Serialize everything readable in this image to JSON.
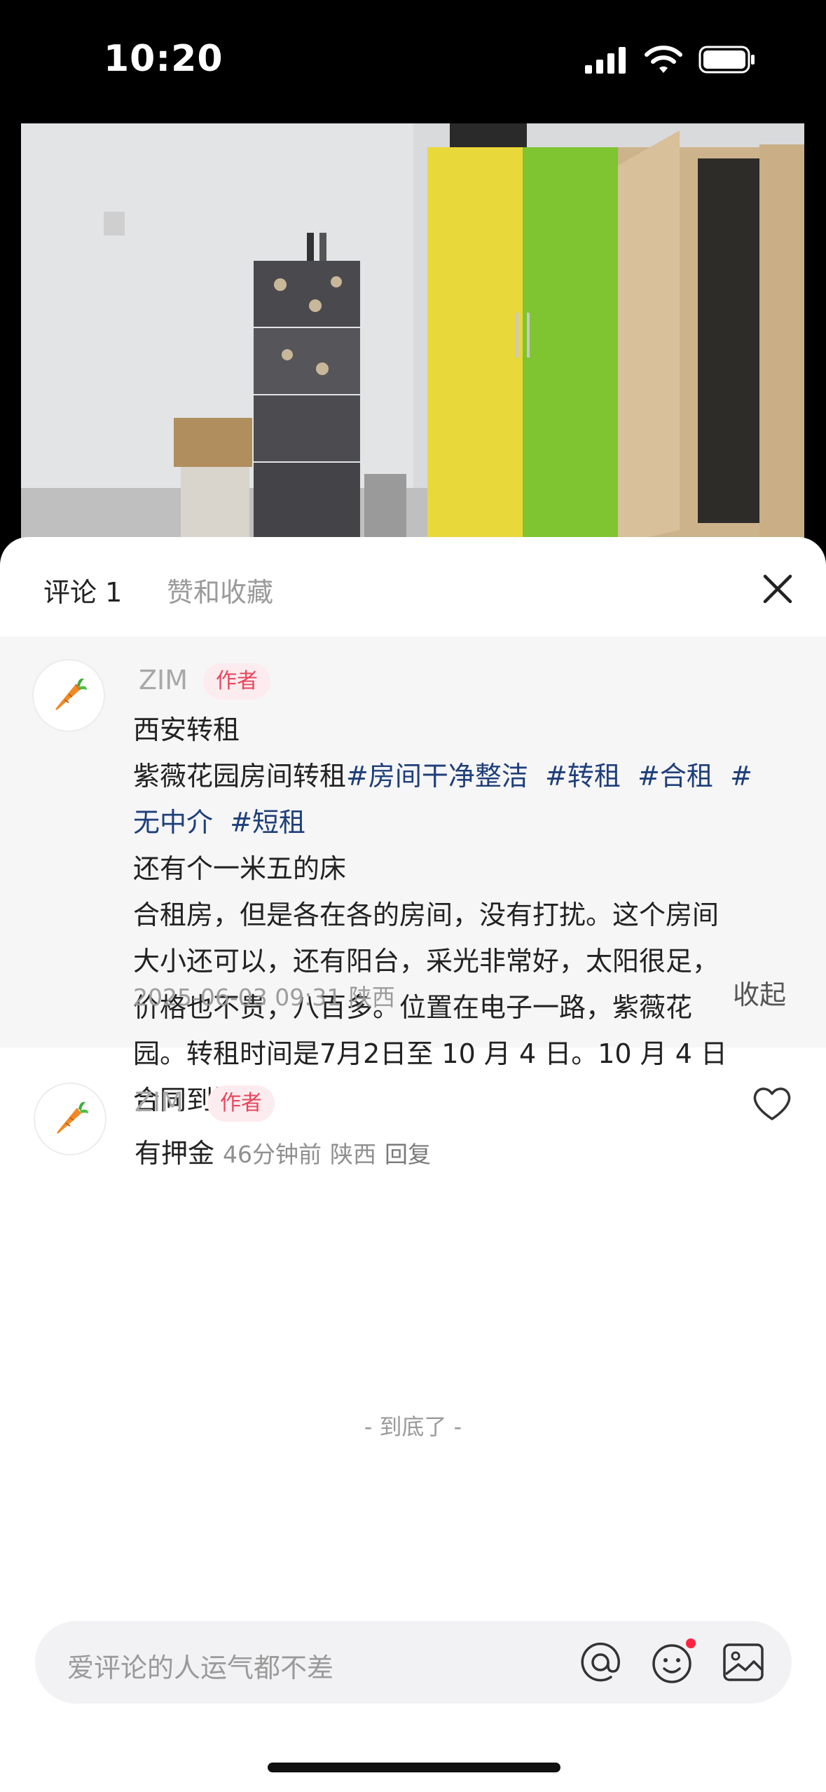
{
  "status_bar": {
    "time": "10:20"
  },
  "tabs": {
    "comments": "评论 1",
    "likes_favorites": "赞和收藏"
  },
  "note": {
    "author": "ZIM",
    "author_badge": "作者",
    "title": "西安转租",
    "line2_text": "紫薇花园房间转租",
    "tags_line2": [
      "#房间干净整洁",
      "#转租",
      "#合租",
      "#"
    ],
    "tags_line3": [
      "无中介",
      "#短租"
    ],
    "body_lines": [
      "还有个一米五的床",
      "合租房，但是各在各的房间，没有打扰。这个房间",
      "大小还可以，还有阳台，采光非常好，太阳很足，",
      "价格也不贵，八百多。位置在电子一路，紫薇花",
      "园。转租时间是7月2日至 10 月 4 日。10 月 4 日",
      "合同到期"
    ],
    "date_location": "2025-06-03 09:31 陕西",
    "collapse_label": "收起"
  },
  "reply": {
    "author": "ZIM",
    "author_badge": "作者",
    "text": "有押金",
    "time": "46分钟前",
    "location": "陕西",
    "reply_label": "回复"
  },
  "end_of_list": "- 到底了 -",
  "comment_input": {
    "placeholder": "爱评论的人运气都不差"
  },
  "colors": {
    "tag": "#1f3f7a",
    "badge_text": "#e8465c",
    "badge_bg": "#fdecef",
    "notification_dot": "#ff2442"
  },
  "icons": [
    "signal-icon",
    "wifi-icon",
    "battery-icon",
    "close-icon",
    "carrot-avatar-icon",
    "heart-icon",
    "at-icon",
    "emoji-icon",
    "image-icon"
  ]
}
